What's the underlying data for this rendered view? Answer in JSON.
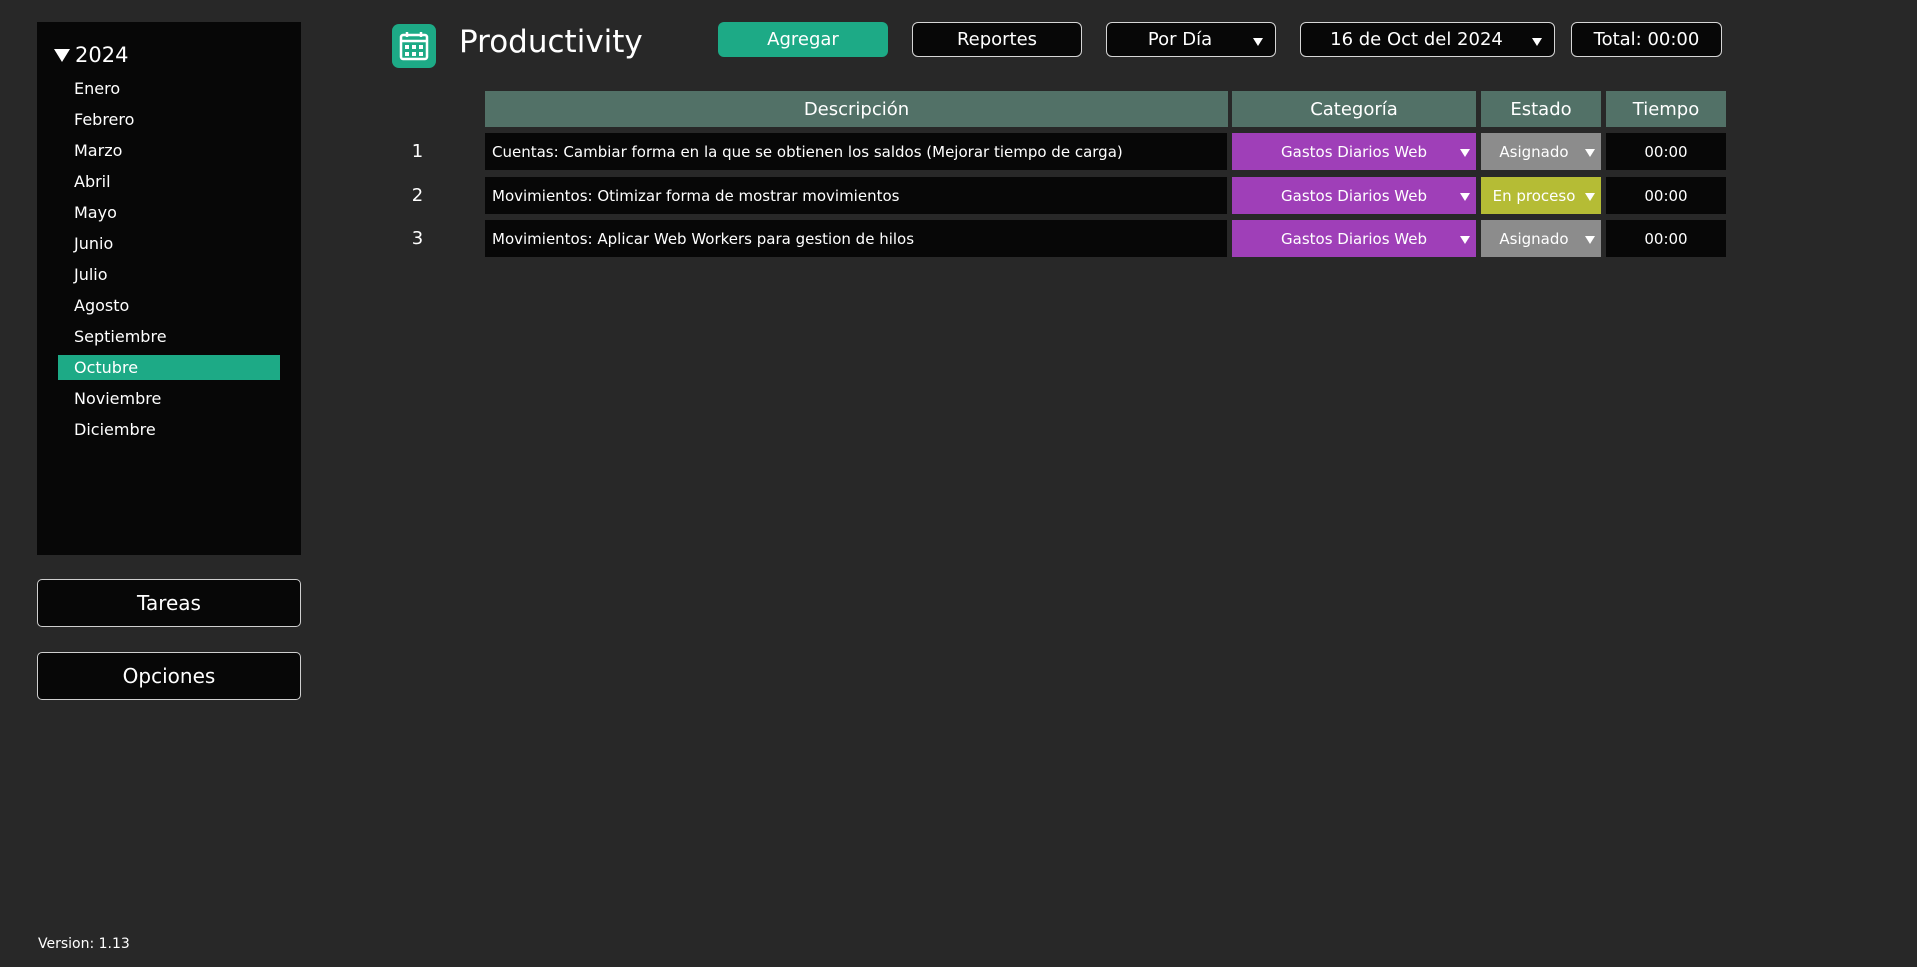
{
  "app": {
    "title": "Productivity",
    "version": "Version: 1.13"
  },
  "sidebar": {
    "year": "2024",
    "months": [
      "Enero",
      "Febrero",
      "Marzo",
      "Abril",
      "Mayo",
      "Junio",
      "Julio",
      "Agosto",
      "Septiembre",
      "Octubre",
      "Noviembre",
      "Diciembre"
    ],
    "selected_month": "Octubre",
    "tasks_button": "Tareas",
    "options_button": "Opciones"
  },
  "toolbar": {
    "add_label": "Agregar",
    "reports_label": "Reportes",
    "view_select": "Por Día",
    "date_select": "16 de Oct del 2024",
    "total": "Total: 00:00"
  },
  "table": {
    "headers": [
      "Descripción",
      "Categoría",
      "Estado",
      "Tiempo"
    ],
    "rows": [
      {
        "num": "1",
        "description": "Cuentas: Cambiar forma en la que se obtienen los saldos (Mejorar tiempo de carga)",
        "category": "Gastos Diarios Web",
        "status": "Asignado",
        "time": "00:00"
      },
      {
        "num": "2",
        "description": "Movimientos: Otimizar forma de mostrar movimientos",
        "category": "Gastos Diarios Web",
        "status": "En proceso",
        "time": "00:00"
      },
      {
        "num": "3",
        "description": "Movimientos: Aplicar Web Workers para gestion de hilos",
        "category": "Gastos Diarios Web",
        "status": "Asignado",
        "time": "00:00"
      }
    ]
  },
  "colors": {
    "accent": "#1daa86",
    "header_bg": "#527167",
    "category_bg": "#9f3fb8",
    "status_assigned": "#8c8c8c",
    "status_in_progress": "#b5bc35"
  },
  "icons": {
    "app": "calendar-icon",
    "year_toggle": "triangle-down-icon",
    "dropdown": "caret-down-icon"
  }
}
